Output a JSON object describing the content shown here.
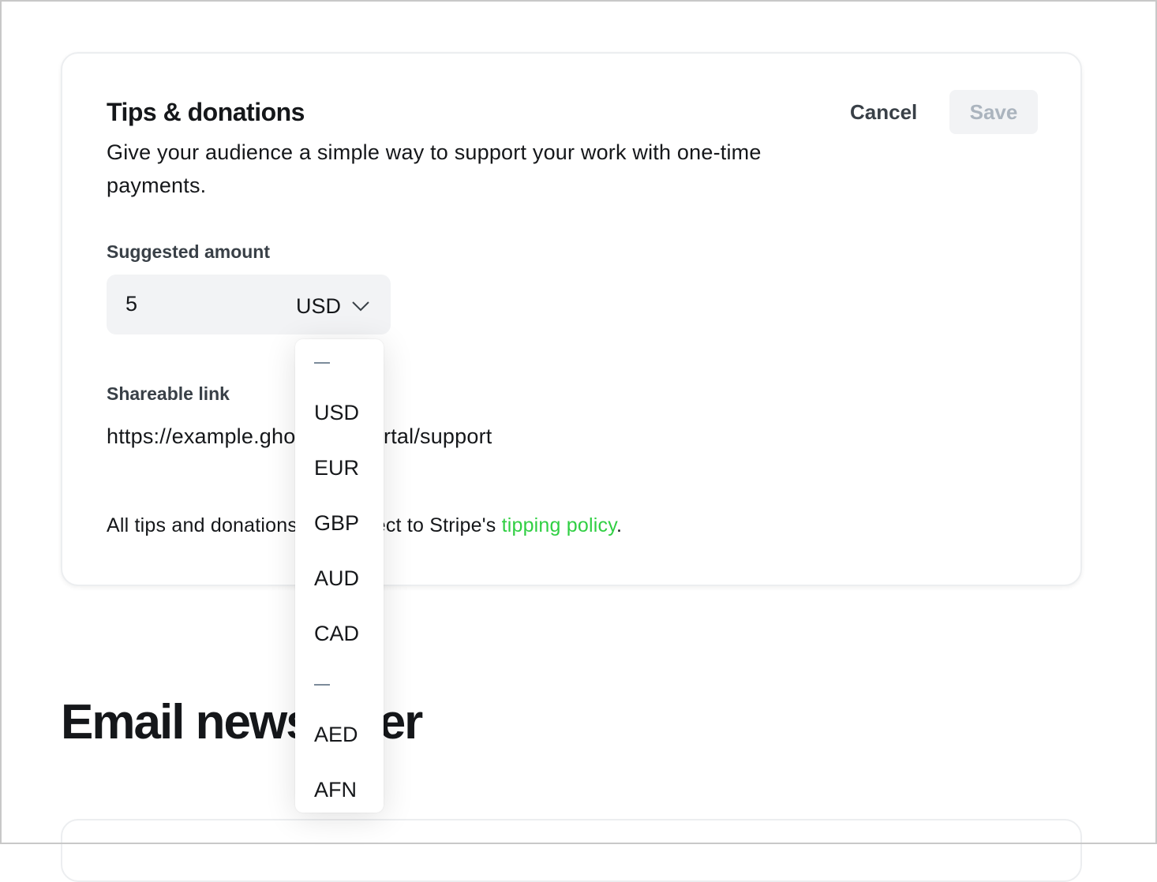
{
  "card": {
    "title": "Tips & donations",
    "description": "Give your audience a simple way to support your work with one-time payments.",
    "cancel_label": "Cancel",
    "save_label": "Save",
    "amount_label": "Suggested amount",
    "amount_value": "5",
    "currency_selected": "USD",
    "link_label": "Shareable link",
    "link_value": "https://example.ghost.io/#/portal/support",
    "footnote_prefix": "All tips and donations are subject to Stripe's ",
    "footnote_link": "tipping policy",
    "footnote_suffix": "."
  },
  "section": {
    "title": "Email newsletter"
  },
  "dropdown": {
    "separator_1": "—",
    "options_top": [
      "USD",
      "EUR",
      "GBP",
      "AUD",
      "CAD"
    ],
    "separator_2": "—",
    "options_rest": [
      "AED",
      "AFN"
    ]
  },
  "icons": {
    "currency_chevron": "chevron-down-icon"
  },
  "colors": {
    "link": "#30cf43",
    "save_disabled_bg": "#f2f3f5",
    "save_disabled_text": "#abb4be"
  }
}
